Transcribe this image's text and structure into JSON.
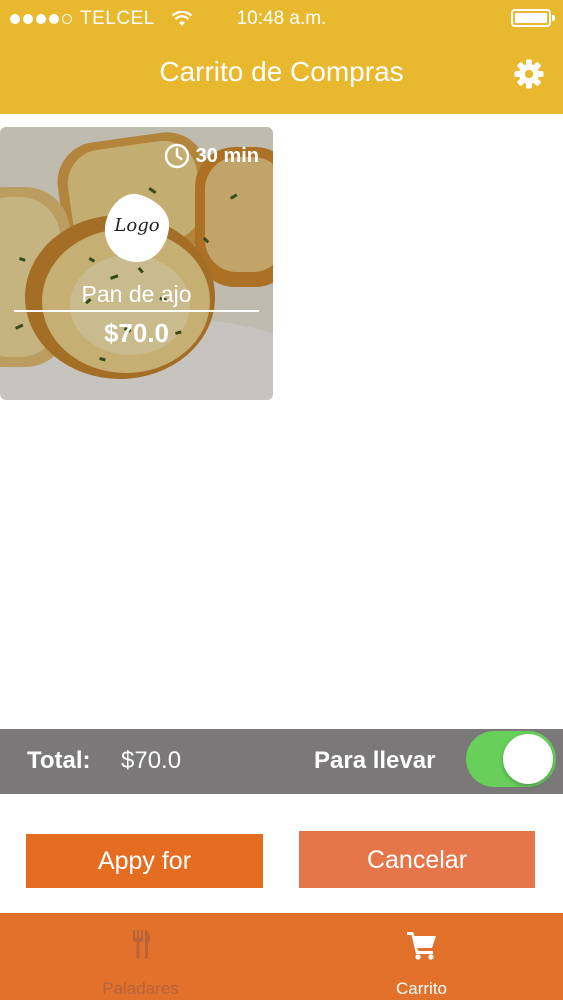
{
  "status_bar": {
    "carrier": "TELCEL",
    "time": "10:48 a.m."
  },
  "header": {
    "title": "Carrito de Compras",
    "settings_icon": "gear-icon",
    "background_color": "#e8b92e"
  },
  "cart_items": [
    {
      "prep_time": "30 min",
      "logo_text": "Logo",
      "name": "Pan de ajo",
      "price": "$70.0"
    }
  ],
  "summary": {
    "total_label": "Total:",
    "total_value": "$70.0",
    "takeaway_label": "Para llevar",
    "takeaway_enabled": true,
    "toggle_color": "#67cf5a"
  },
  "actions": {
    "apply_label": "Appy for",
    "cancel_label": "Cancelar",
    "accent_color": "#e56d22"
  },
  "tabbar": {
    "tabs": [
      {
        "label": "Paladares",
        "icon": "fork-knife-icon",
        "active": false
      },
      {
        "label": "Carrito",
        "icon": "cart-icon",
        "active": true
      }
    ]
  }
}
